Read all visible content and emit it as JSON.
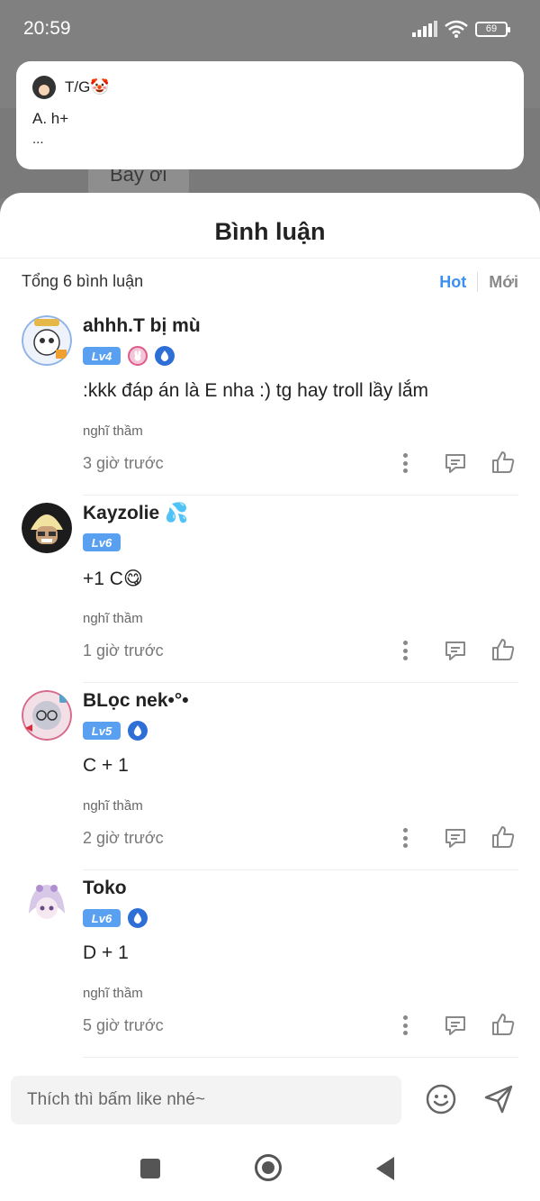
{
  "status_bar": {
    "time": "20:59",
    "battery": "69"
  },
  "notification": {
    "sender": "T/G🤡",
    "line1": "A. h+",
    "line2": "..."
  },
  "background": {
    "chip_text": "Bay ơi"
  },
  "sheet": {
    "title": "Bình luận",
    "total_label": "Tổng 6 bình luận",
    "tab_hot": "Hot",
    "tab_new": "Mới"
  },
  "comments": [
    {
      "username": "ahhh.T bị mù",
      "level": "Lv4",
      "content": ":kkk đáp án là E nha :) tg hay troll lầy lắm",
      "mood": "nghĩ thầm",
      "time": "3 giờ trước"
    },
    {
      "username": "Kayzolie 💦",
      "level": "Lv6",
      "content": "+1 C😋",
      "mood": "nghĩ thầm",
      "time": "1 giờ trước"
    },
    {
      "username": "BLọc nek•°•",
      "level": "Lv5",
      "content": "C + 1",
      "mood": "nghĩ thầm",
      "time": "2 giờ trước"
    },
    {
      "username": "Toko",
      "level": "Lv6",
      "content": "D + 1",
      "mood": "nghĩ thầm",
      "time": "5 giờ trước"
    }
  ],
  "input": {
    "placeholder": "Thích thì bấm like nhé~"
  },
  "colors": {
    "accent": "#3b8ff0",
    "level_badge": "#5aa0f0",
    "icon_gray": "#888888"
  }
}
